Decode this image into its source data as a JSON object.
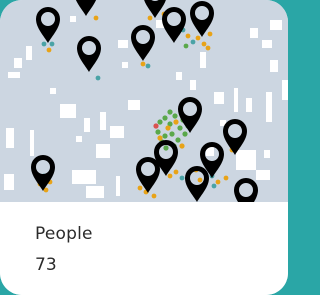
{
  "map_card": {
    "label": "People",
    "count": "73"
  },
  "map": {
    "marker_icon": "location-pin-icon",
    "marker_count": 15,
    "colors": {
      "map_background": "#ccd6e1",
      "buildings": "#ffffff",
      "marker": "#000000",
      "dot_orange": "#e8a317",
      "dot_green": "#5aa84a",
      "dot_teal": "#4aa3a6",
      "dot_red": "#d9534f"
    }
  }
}
